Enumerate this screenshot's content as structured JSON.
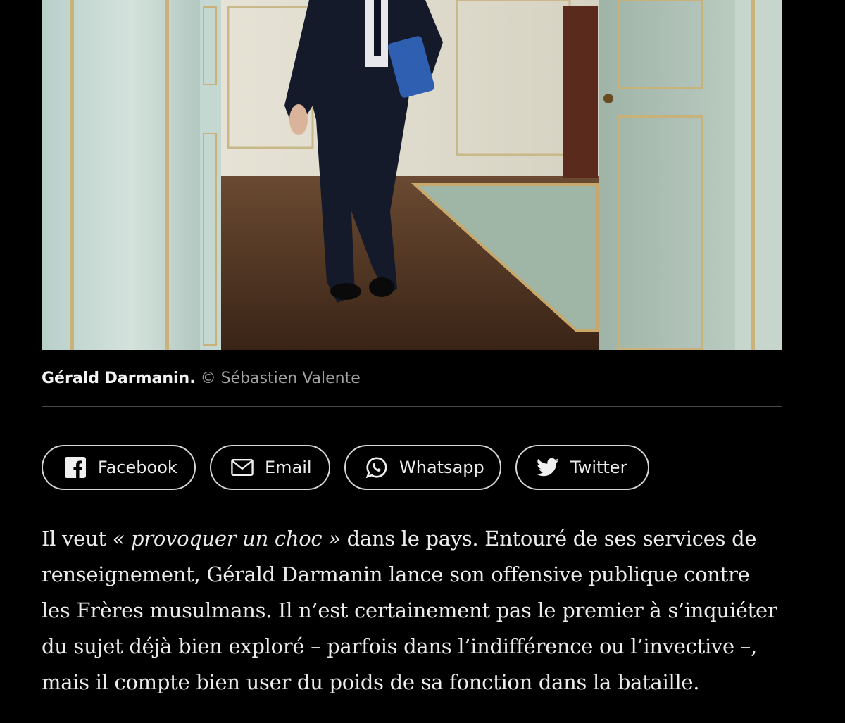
{
  "photo": {
    "description_icon": "photo"
  },
  "caption": {
    "name": "Gérald Darmanin.",
    "credit": "© Sébastien Valente"
  },
  "share": {
    "facebook": "Facebook",
    "email": "Email",
    "whatsapp": "Whatsapp",
    "twitter": "Twitter"
  },
  "article": {
    "l1_pre": "Il veut ",
    "l1_quote": "« provoquer un choc »",
    "l1_post": " dans le pays. Entouré de ses services de",
    "l2": "renseignement, Gérald Darmanin lance son offensive publique contre",
    "l3": "les Frères musulmans. Il n’est certainement pas le premier à s’inquiéter",
    "l4": "du sujet déjà bien exploré – parfois dans l’indifférence ou l’invective –,",
    "l5": "mais il compte bien user du poids de sa fonction dans la bataille."
  },
  "colors": {
    "background": "#000000",
    "text": "#ececec",
    "credit": "#a3a3a3"
  }
}
